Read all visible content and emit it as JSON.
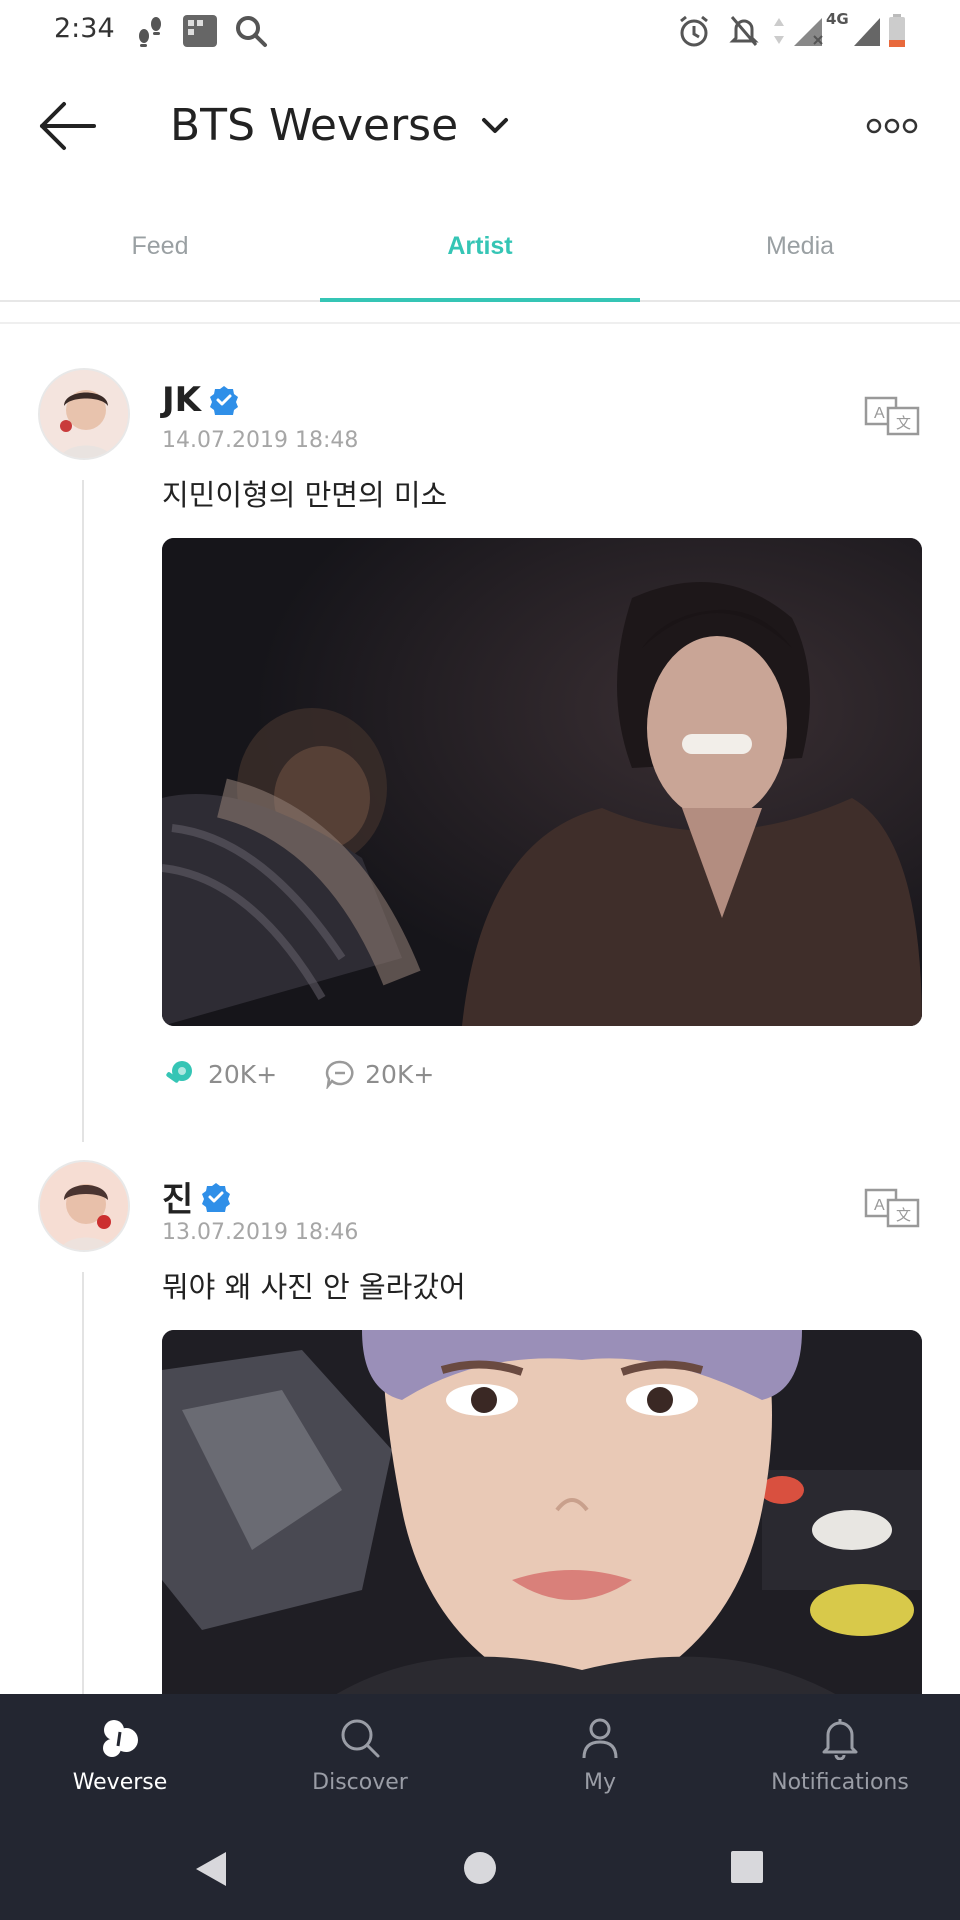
{
  "status_bar": {
    "time": "2:34",
    "network": "4G",
    "icons": [
      "footsteps-icon",
      "photo-grid-icon",
      "search-icon",
      "alarm-icon",
      "bell-off-icon",
      "data-arrows-icon",
      "signal-icon",
      "signal-4g-icon",
      "battery-icon"
    ]
  },
  "header": {
    "title": "BTS Weverse",
    "back_icon": "arrow-left-icon",
    "dropdown_icon": "chevron-down-icon",
    "more_icon": "more-dots-icon"
  },
  "tabs": [
    {
      "label": "Feed",
      "active": false
    },
    {
      "label": "Artist",
      "active": true
    },
    {
      "label": "Media",
      "active": false
    }
  ],
  "accent_color": "#35c5b5",
  "verified_color": "#2f8fe8",
  "posts": [
    {
      "author": "JK",
      "verified": true,
      "date": "14.07.2019 18:48",
      "text": "지민이형의 만면의 미소",
      "likes": "20K+",
      "comments": "20K+",
      "image_description": "dark selfie of two people smiling"
    },
    {
      "author": "진",
      "verified": true,
      "date": "13.07.2019 18:46",
      "text": "뭐야 왜 사진 안 올라갔어",
      "image_description": "close-up selfie with purple hair backstage"
    }
  ],
  "bottom_nav": [
    {
      "label": "Weverse",
      "icon": "weverse-logo-icon",
      "active": true
    },
    {
      "label": "Discover",
      "icon": "search-icon",
      "active": false
    },
    {
      "label": "My",
      "icon": "person-icon",
      "active": false
    },
    {
      "label": "Notifications",
      "icon": "bell-icon",
      "active": false
    }
  ],
  "system_nav": [
    "back-triangle-icon",
    "home-circle-icon",
    "recents-square-icon"
  ]
}
